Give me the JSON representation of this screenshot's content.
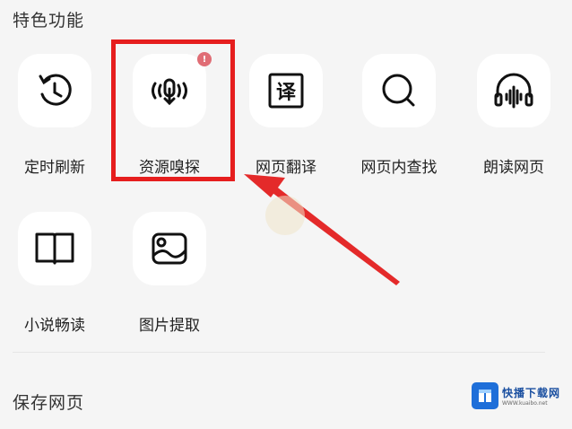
{
  "sections": {
    "features_title": "特色功能",
    "save_title": "保存网页"
  },
  "features": [
    {
      "label": "定时刷新",
      "icon": "clock-refresh-icon"
    },
    {
      "label": "资源嗅探",
      "icon": "resource-sniff-icon",
      "badge": "!"
    },
    {
      "label": "网页翻译",
      "icon": "translate-icon"
    },
    {
      "label": "网页内查找",
      "icon": "search-in-page-icon"
    },
    {
      "label": "朗读网页",
      "icon": "headphones-read-icon"
    },
    {
      "label": "小说畅读",
      "icon": "open-book-icon"
    },
    {
      "label": "图片提取",
      "icon": "image-extract-icon"
    }
  ],
  "translate_glyph": "译",
  "watermark": {
    "name": "快播下载网",
    "url": "WWW.kuaibo.net"
  },
  "colors": {
    "background": "#f5f5f5",
    "tile": "#ffffff",
    "highlight": "#e61e1e",
    "badge": "#e06d75"
  }
}
